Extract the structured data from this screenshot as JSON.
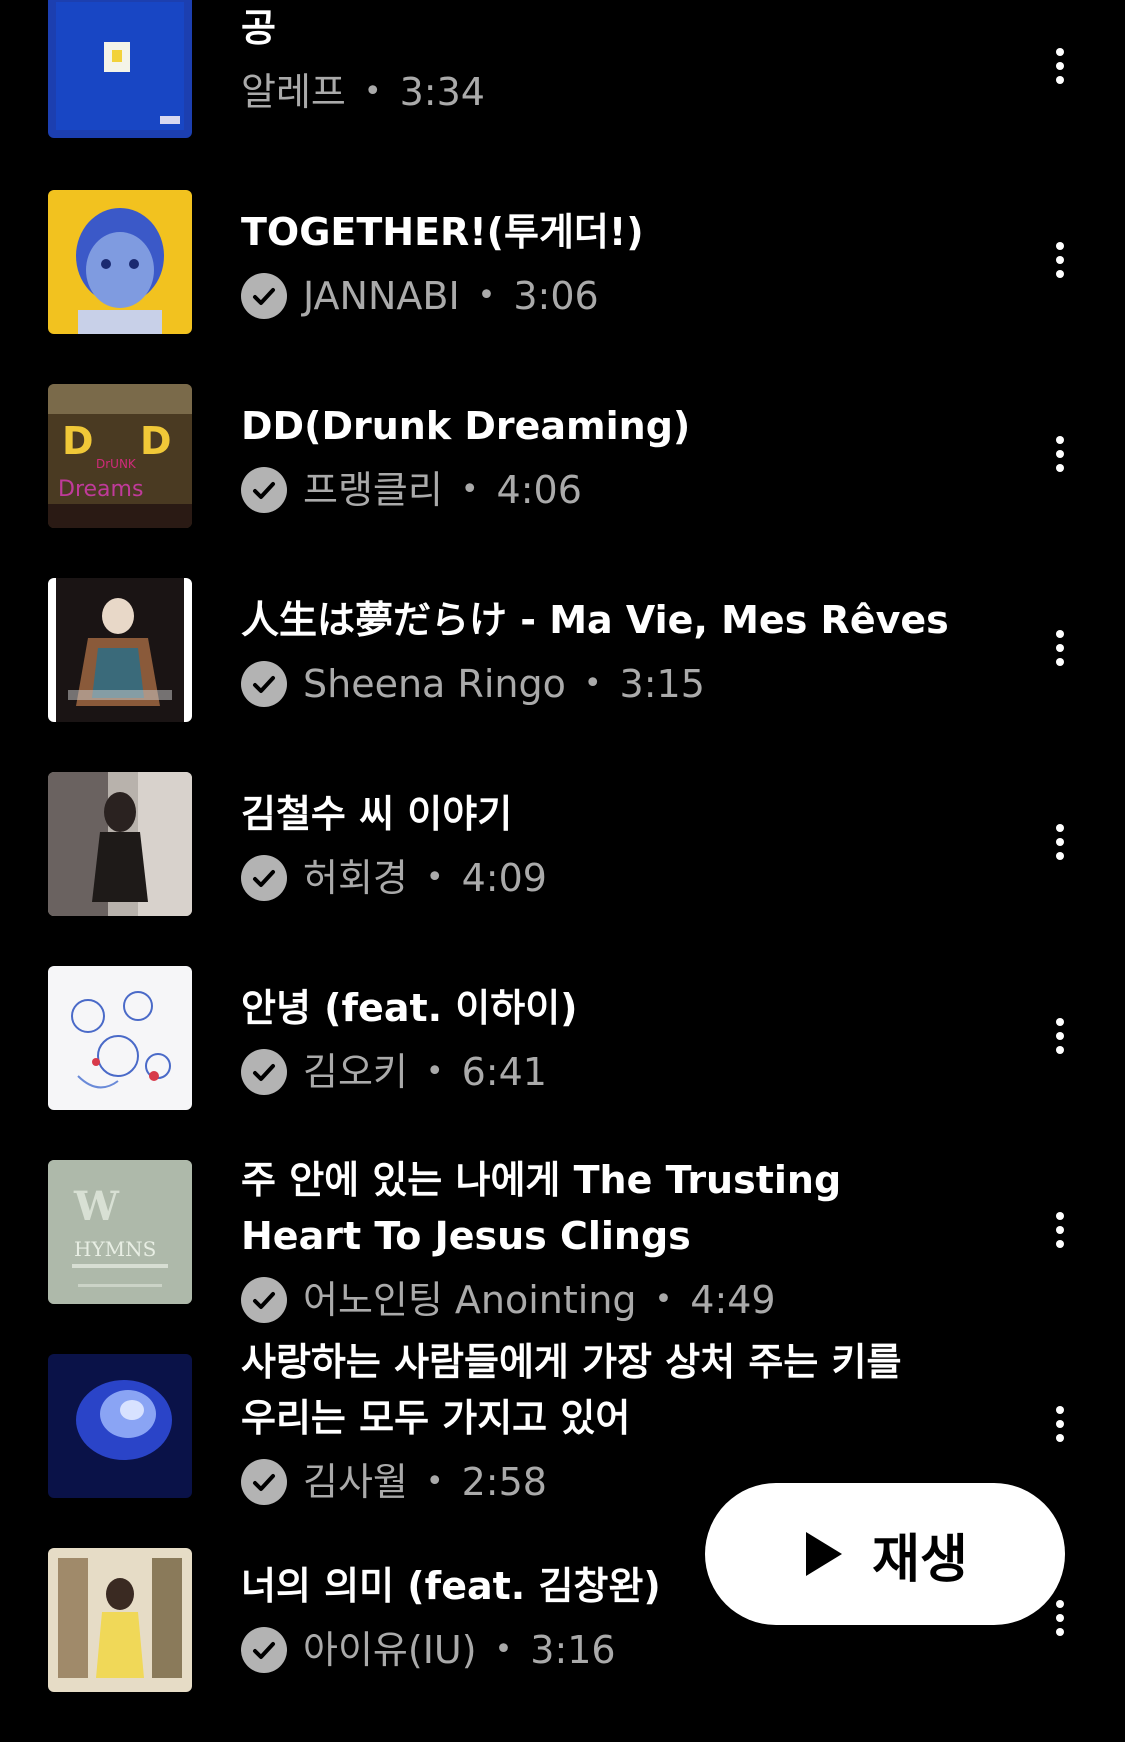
{
  "songs": [
    {
      "title": "공",
      "title_line2": "",
      "artist": "알레프",
      "duration": "3:34",
      "verified": false,
      "art": "blue-square-art"
    },
    {
      "title": "TOGETHER!(투게더!)",
      "title_line2": "",
      "artist": "JANNABI",
      "duration": "3:06",
      "verified": true,
      "art": "blue-boy-portrait-art"
    },
    {
      "title": "DD(Drunk Dreaming)",
      "title_line2": "",
      "artist": "프랭클리",
      "duration": "4:06",
      "verified": true,
      "art": "drunk-dreaming-art"
    },
    {
      "title": "人生は夢だらけ - Ma Vie, Mes Rêves",
      "title_line2": "",
      "artist": "Sheena Ringo",
      "duration": "3:15",
      "verified": true,
      "art": "kimono-portrait-art"
    },
    {
      "title": "김철수 씨 이야기",
      "title_line2": "",
      "artist": "허회경",
      "duration": "4:09",
      "verified": true,
      "art": "woman-sitting-photo-art"
    },
    {
      "title": "안녕 (feat. 이하이)",
      "title_line2": "",
      "artist": "김오키",
      "duration": "6:41",
      "verified": true,
      "art": "doodle-drawing-art"
    },
    {
      "title": "주 안에 있는 나에게 The Trusting",
      "title_line2": "Heart To Jesus Clings",
      "artist": "어노인팅 Anointing",
      "duration": "4:49",
      "verified": true,
      "art": "hymns-cover-art"
    },
    {
      "title": "사랑하는 사람들에게 가장 상처 주는 키를",
      "title_line2": "우리는 모두 가지고 있어",
      "artist": "김사월",
      "duration": "2:58",
      "verified": true,
      "art": "blue-glow-photo-art"
    },
    {
      "title": "너의 의미 (feat. 김창완)",
      "title_line2": "",
      "artist": "아이유(IU)",
      "duration": "3:16",
      "verified": true,
      "art": "bookshelf-photo-art"
    }
  ],
  "play_button": {
    "label": "재생",
    "icon": "play-icon"
  },
  "separator": "•",
  "icons": {
    "more": "more-vert-icon",
    "verified": "verified-check-icon"
  },
  "colors": {
    "background": "#000000",
    "title": "#ffffff",
    "meta": "#aaaaaa",
    "button_bg": "#ffffff"
  }
}
